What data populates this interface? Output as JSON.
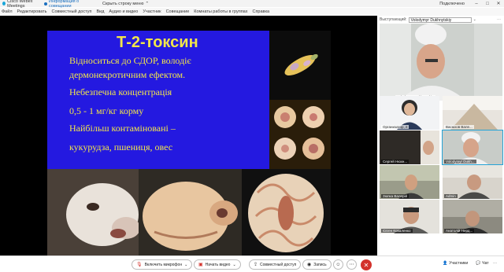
{
  "titlebar": {
    "app_name": "Cisco Webex Meetings",
    "meeting_info": "Информация о совещании",
    "hide_menu": "Скрыть строку меню",
    "connected": "Подключено",
    "minimize": "–",
    "maximize": "□",
    "close": "✕"
  },
  "menu": [
    "Файл",
    "Редактировать",
    "Совместный доступ",
    "Вид",
    "Аудио и видео",
    "Участник",
    "Совещание",
    "Комнаты работы в группах",
    "Справка"
  ],
  "slide": {
    "title": "Т-2-токсин",
    "lines": [
      "Відноситься до СДОР, володіє",
      "дермонекротичним ефектом.",
      "Небезпечна концентрація",
      "0,5 - 1 мг/кг корму",
      "Найбільш контаміновані –",
      "кукурудза,  пшениця,  овес"
    ]
  },
  "panel": {
    "speaker_label": "Выступающий:",
    "speaker_name": "Volodymyr Dukhnytskiy",
    "speaker_tile_name": "Volodymyr Dukhnytskiy",
    "participants": [
      "Организатор, я",
      "Васюхов Вале...",
      "Сергей Нюхн...",
      "Volodymyr Dukh...",
      "Зюпка Валерій",
      "Admin",
      "Євген Коваленко",
      "Анатолій Нерд..."
    ]
  },
  "toolbar": {
    "unmute": "Включить микрофон",
    "start_video": "Начать видео",
    "share": "Совместный доступ",
    "record": "Запись",
    "participants": "Участники",
    "chat": "Чат"
  },
  "colors": {
    "slide_bg": "#2419e0",
    "slide_text": "#f2e64a",
    "active_border": "#25a3d6",
    "end_call": "#d3322c"
  }
}
